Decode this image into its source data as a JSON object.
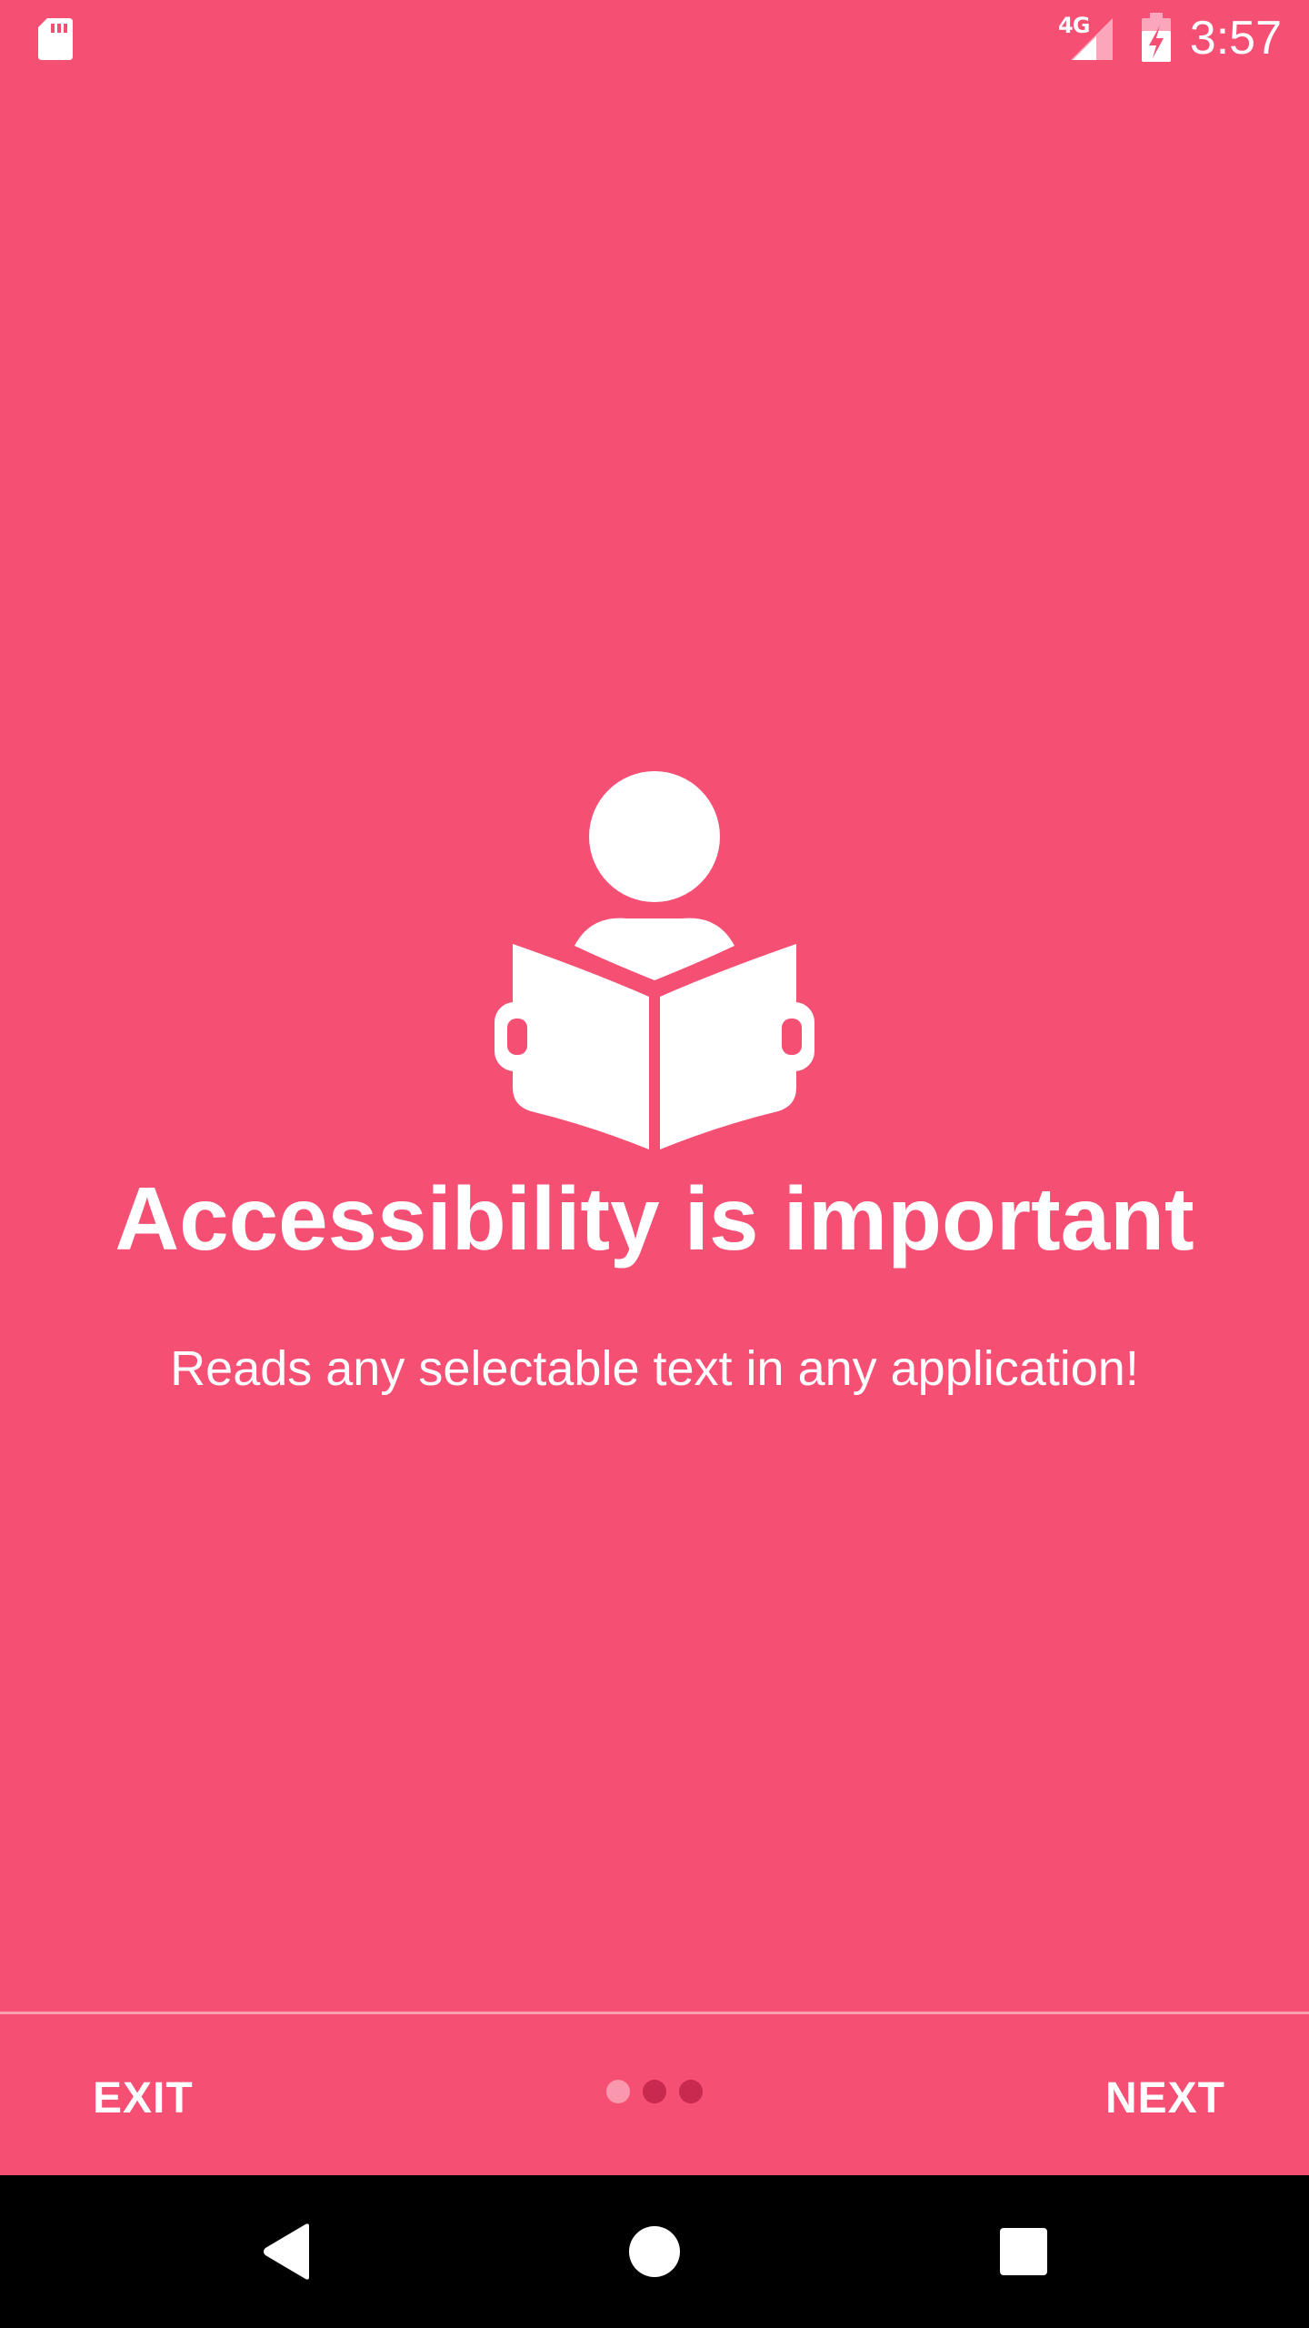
{
  "status_bar": {
    "time": "3:57",
    "network_type": "4G",
    "icons": [
      "sd-card-icon",
      "signal-icon",
      "battery-charging-icon"
    ]
  },
  "onboarding": {
    "icon": "person-reading-icon",
    "title": "Accessibility is important",
    "description": "Reads any selectable text in any application!",
    "page_count": 3,
    "current_page": 1
  },
  "controls": {
    "exit_label": "EXIT",
    "next_label": "NEXT"
  },
  "nav_bar": {
    "icons": [
      "back-icon",
      "home-icon",
      "recents-icon"
    ]
  },
  "colors": {
    "background": "#F64F74",
    "text": "#FFFFFF",
    "dot_active": "#F897AE",
    "dot_inactive": "#C8294F",
    "nav_bar": "#000000"
  }
}
